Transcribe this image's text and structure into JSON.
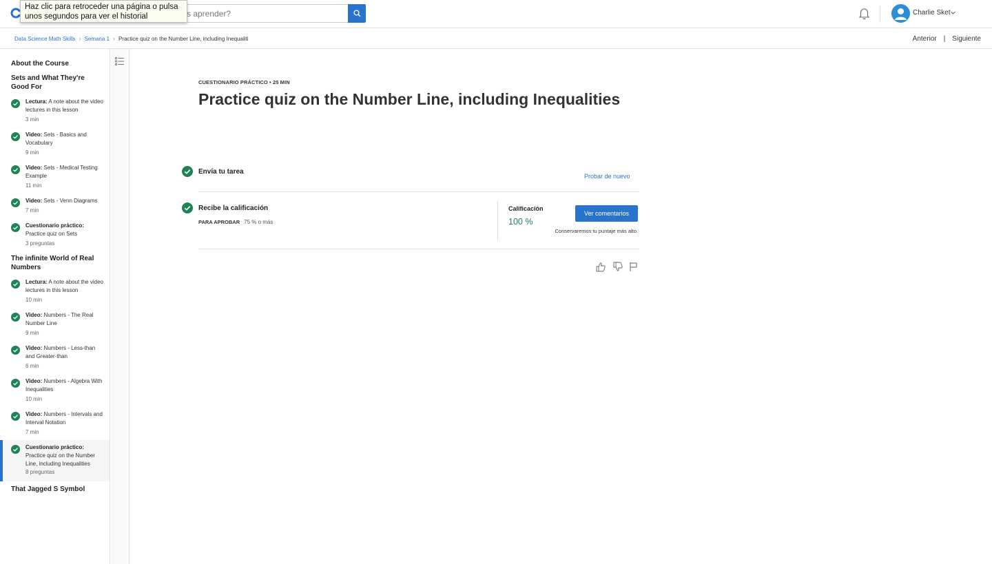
{
  "header": {
    "search_placeholder": "s aprender?",
    "tooltip": "Haz clic para retroceder una página o pulsa unos segundos para ver el historial",
    "user_name": "Charlie Sket"
  },
  "breadcrumb": {
    "course": "Data Science Math Skills",
    "week": "Semana 1",
    "page": "Practice quiz on the Number Line, including Inequaliti",
    "sep": "›"
  },
  "nav": {
    "previous": "Anterior",
    "separator": "|",
    "next": "Siguiente"
  },
  "sidebar": {
    "sections": [
      {
        "title": "About the Course"
      },
      {
        "title": "Sets and What They're Good For"
      },
      {
        "title": "The infinite World of Real Numbers"
      },
      {
        "title": "That Jagged S Symbol"
      }
    ],
    "items": [
      {
        "kind": "Lectura:",
        "text": "A note about the video lectures in this lesson",
        "meta": "3 min"
      },
      {
        "kind": "Video:",
        "text": "Sets - Basics and Vocabulary",
        "meta": "9 min"
      },
      {
        "kind": "Video:",
        "text": "Sets - Medical Testing Example",
        "meta": "11 min"
      },
      {
        "kind": "Video:",
        "text": "Sets - Venn Diagrams",
        "meta": "7 min"
      },
      {
        "kind": "Cuestionario práctico:",
        "text": "Practice quiz on Sets",
        "meta": "3 preguntas"
      },
      {
        "kind": "Lectura:",
        "text": "A note about the video lectures in this lesson",
        "meta": "10 min"
      },
      {
        "kind": "Video:",
        "text": "Numbers - The Real Number Line",
        "meta": "9 min"
      },
      {
        "kind": "Video:",
        "text": "Numbers - Less-than and Greater-than",
        "meta": "6 min"
      },
      {
        "kind": "Video:",
        "text": "Numbers - Algebra With Inequalities",
        "meta": "10 min"
      },
      {
        "kind": "Video:",
        "text": "Numbers - Intervals and Interval Notation",
        "meta": "7 min"
      },
      {
        "kind": "Cuestionario práctico:",
        "text": "Practice quiz on the Number Line, including Inequalities",
        "meta": "8 preguntas"
      }
    ]
  },
  "main": {
    "kicker": "CUESTIONARIO PRÁCTICO • 25 MIN",
    "title": "Practice quiz on the Number Line, including Inequalities",
    "submit_label": "Envía tu tarea",
    "retry_label": "Probar de nuevo",
    "receive_label": "Recibe la calificación",
    "pass_label": "PARA APROBAR",
    "pass_value": "75 % o más",
    "grade_label": "Calificación",
    "grade_value": "100 %",
    "feedback_button": "Ver comentarios",
    "keep_note": "Conservaremos tu puntaje más alto."
  },
  "colors": {
    "accent": "#2a73cc",
    "success": "#1f8354",
    "check": "#1f8354"
  }
}
